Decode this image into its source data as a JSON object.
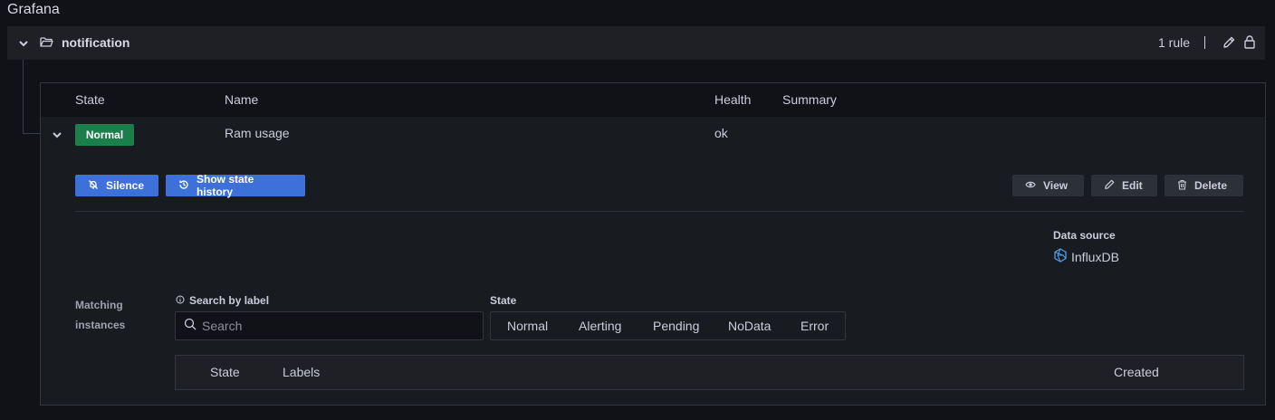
{
  "app": {
    "title": "Grafana"
  },
  "folder": {
    "name": "notification",
    "rule_count": "1 rule",
    "icons": {
      "collapse": "chevron-down-icon",
      "folder": "folder-open-icon",
      "edit": "pencil-icon",
      "lock": "lock-icon"
    }
  },
  "table": {
    "columns": {
      "state": "State",
      "name": "Name",
      "health": "Health",
      "summary": "Summary"
    }
  },
  "rule": {
    "state": "Normal",
    "state_color": "#1a7f4b",
    "name": "Ram usage",
    "health": "ok",
    "summary": ""
  },
  "actions": {
    "silence": "Silence",
    "show_history": "Show state history",
    "view": "View",
    "edit": "Edit",
    "delete": "Delete"
  },
  "datasource": {
    "label": "Data source",
    "name": "InfluxDB"
  },
  "instances": {
    "label": "Matching instances",
    "search_label": "Search by label",
    "search_placeholder": "Search",
    "state_label": "State",
    "state_options": [
      "Normal",
      "Alerting",
      "Pending",
      "NoData",
      "Error"
    ],
    "columns": {
      "state": "State",
      "labels": "Labels",
      "created": "Created"
    }
  },
  "colors": {
    "primary": "#3d71d9",
    "background": "#111217",
    "panel": "#181b1f"
  }
}
